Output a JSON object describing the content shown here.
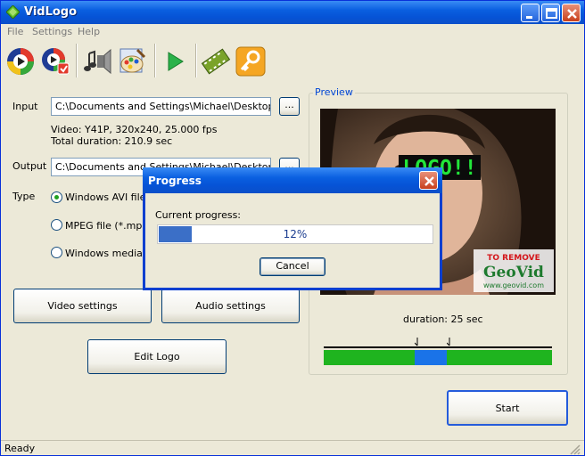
{
  "window": {
    "title": "VidLogo"
  },
  "menu": [
    "File",
    "Settings",
    "Help"
  ],
  "toolbar": {
    "icons": [
      "convert-icon",
      "batch-convert-icon",
      "audio-icon",
      "paint-icon",
      "play-icon",
      "film-icon",
      "key-icon"
    ]
  },
  "input": {
    "label": "Input",
    "value": "C:\\Documents and Settings\\Michael\\Desktop\\Arm",
    "browse": "...",
    "info1": "Video: Y41P, 320x240, 25.000 fps",
    "info2": "Total duration: 210.9 sec"
  },
  "output": {
    "label": "Output",
    "value": "C:\\Documents and Settings\\Michael\\Desktop\\Arm",
    "browse": "..."
  },
  "type": {
    "label": "Type",
    "options": [
      {
        "label": "Windows AVI file (",
        "selected": true
      },
      {
        "label": "MPEG file (*.mpg o",
        "selected": false
      },
      {
        "label": "Windows media vid",
        "selected": false
      }
    ]
  },
  "buttons": {
    "video_settings": "Video settings",
    "audio_settings": "Audio settings",
    "edit_logo": "Edit Logo",
    "start": "Start"
  },
  "preview": {
    "title": "Preview",
    "logo_text": "LOGO!!",
    "watermark_top": "TO REMOVE",
    "watermark_brand": "GeoVid",
    "watermark_url": "www.geovid.com",
    "duration": "duration: 25 sec",
    "selection_start": 0.4,
    "selection_end": 0.54
  },
  "status": {
    "text": "Ready"
  },
  "dialog": {
    "title": "Progress",
    "label": "Current progress:",
    "percent_text": "12%",
    "percent_value": 0.12,
    "cancel": "Cancel"
  },
  "colors": {
    "titlebar": "#0a5fe0",
    "timeline_green": "#1fb41f",
    "timeline_blue": "#1a73e8",
    "progress_fill": "#3b6fc7"
  }
}
